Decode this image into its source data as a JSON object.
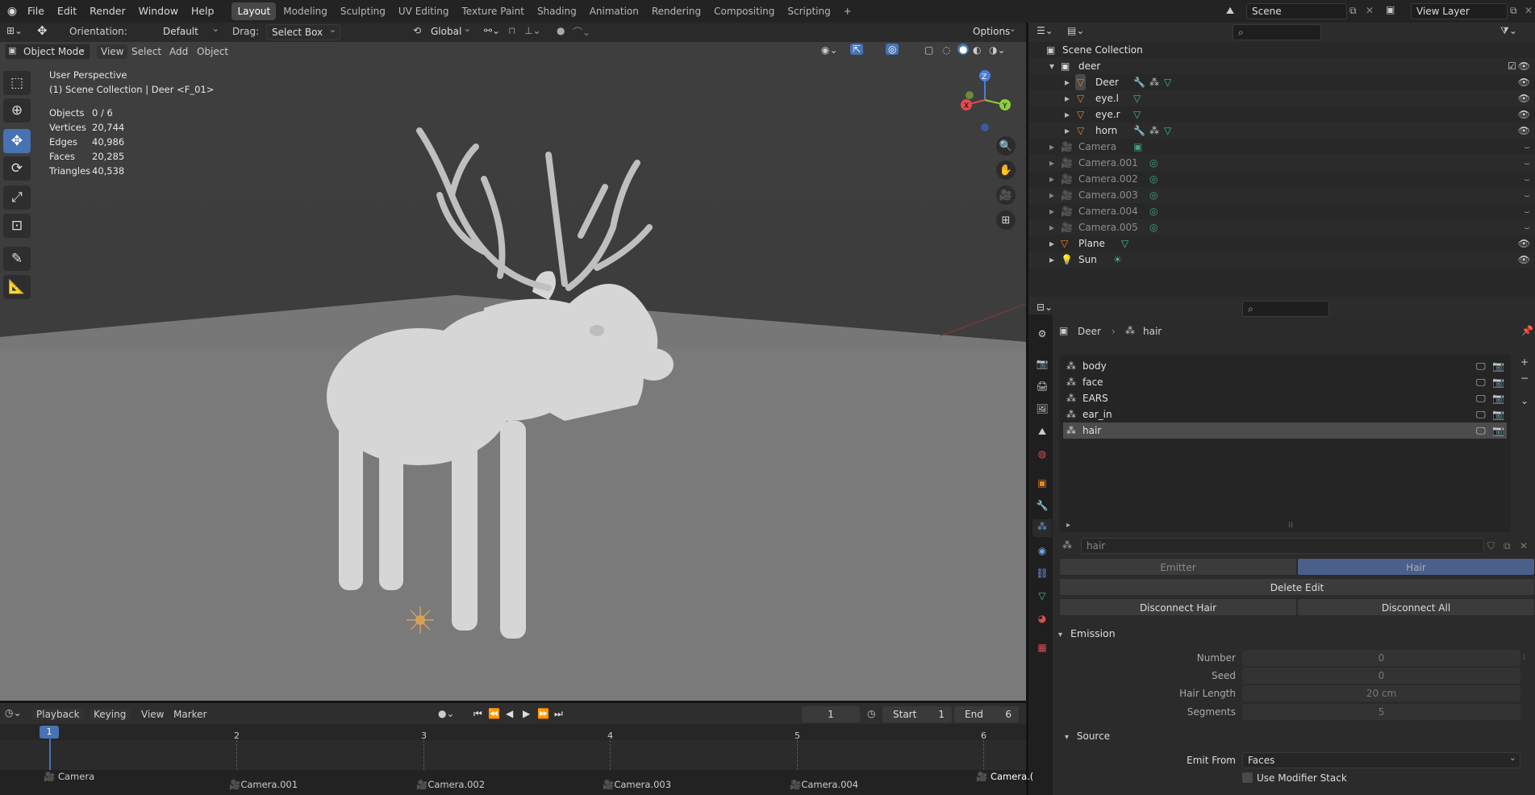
{
  "topbar": {
    "menus": [
      "File",
      "Edit",
      "Render",
      "Window",
      "Help"
    ],
    "workspaces": [
      "Layout",
      "Modeling",
      "Sculpting",
      "UV Editing",
      "Texture Paint",
      "Shading",
      "Animation",
      "Rendering",
      "Compositing",
      "Scripting"
    ],
    "active_workspace": "Layout",
    "add_tab": "+",
    "scene": "Scene",
    "view_layer": "View Layer"
  },
  "tool_settings": {
    "orientation_label": "Orientation:",
    "orientation_value": "Default",
    "drag_label": "Drag:",
    "drag_value": "Select Box",
    "transform_value": "Global",
    "options": "Options"
  },
  "viewport_header": {
    "mode": "Object Mode",
    "menus": [
      "View",
      "Select",
      "Add",
      "Object"
    ]
  },
  "viewport": {
    "perspective": "User Perspective",
    "context": "(1) Scene Collection | Deer <F_01>",
    "stats": [
      {
        "label": "Objects",
        "value": "0 / 6"
      },
      {
        "label": "Vertices",
        "value": "20,744"
      },
      {
        "label": "Edges",
        "value": "40,986"
      },
      {
        "label": "Faces",
        "value": "20,285"
      },
      {
        "label": "Triangles",
        "value": "40,538"
      }
    ],
    "gizmo": {
      "x": "X",
      "y": "Y",
      "z": "Z"
    }
  },
  "outliner": {
    "root": "Scene Collection",
    "collection": "deer",
    "children": [
      "Deer",
      "eye.l",
      "eye.r",
      "horn"
    ],
    "objects": [
      "Camera",
      "Camera.001",
      "Camera.002",
      "Camera.003",
      "Camera.004",
      "Camera.005",
      "Plane",
      "Sun"
    ]
  },
  "properties": {
    "breadcrumb_object": "Deer",
    "breadcrumb_system": "hair",
    "systems": [
      "body",
      "face",
      "EARS",
      "ear_in",
      "hair"
    ],
    "selected_system": "hair",
    "settings_name": "hair",
    "type_emitter": "Emitter",
    "type_hair": "Hair",
    "delete_edit": "Delete Edit",
    "disconnect_hair": "Disconnect Hair",
    "disconnect_all": "Disconnect All",
    "emission_title": "Emission",
    "emission": [
      {
        "label": "Number",
        "value": "0"
      },
      {
        "label": "Seed",
        "value": "0"
      },
      {
        "label": "Hair Length",
        "value": "20 cm"
      },
      {
        "label": "Segments",
        "value": "5"
      }
    ],
    "source_title": "Source",
    "emit_from_label": "Emit From",
    "emit_from_value": "Faces",
    "use_modifier_stack": "Use Modifier Stack"
  },
  "timeline": {
    "menus": [
      "Playback",
      "Keying",
      "View",
      "Marker"
    ],
    "current_frame": "1",
    "start_label": "Start",
    "start_value": "1",
    "end_label": "End",
    "end_value": "6",
    "frames": [
      "1",
      "2",
      "3",
      "4",
      "5",
      "6"
    ],
    "markers": [
      "Camera",
      "Camera.001",
      "Camera.002",
      "Camera.003",
      "Camera.004",
      "Camera.("
    ]
  },
  "colors": {
    "accent": "#4772b3",
    "object_orange": "#e8872a",
    "mesh_green": "#40c080"
  }
}
